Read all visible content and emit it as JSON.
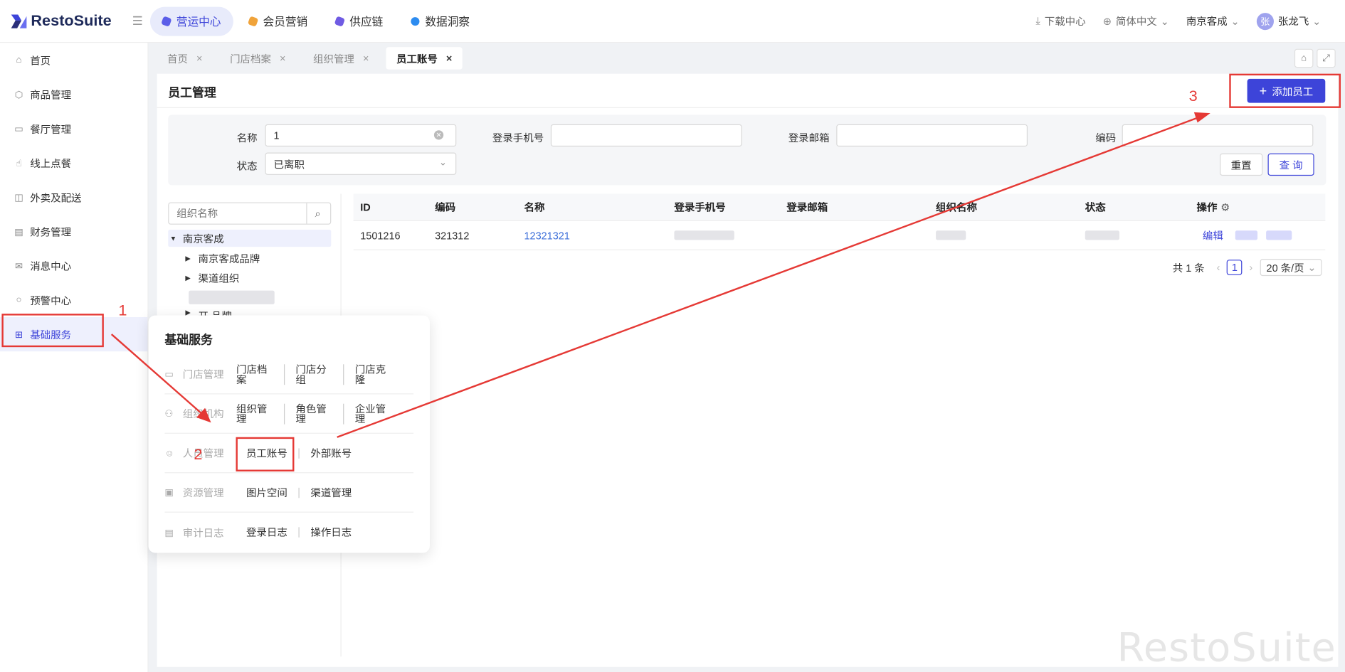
{
  "header": {
    "logo_text": "RestoSuite",
    "nav": [
      {
        "label": "营运中心",
        "active": true,
        "color": "#5b5ee8"
      },
      {
        "label": "会员营销",
        "active": false,
        "color": "#f0a33a"
      },
      {
        "label": "供应链",
        "active": false,
        "color": "#6f5be3"
      },
      {
        "label": "数据洞察",
        "active": false,
        "color": "#2d8cf0"
      }
    ],
    "download": "下载中心",
    "language": "简体中文",
    "store": "南京客成",
    "avatar_char": "张",
    "user": "张龙飞"
  },
  "sidebar": {
    "items": [
      {
        "label": "首页",
        "icon": "home-icon",
        "active": false
      },
      {
        "label": "商品管理",
        "icon": "box-icon",
        "active": false
      },
      {
        "label": "餐厅管理",
        "icon": "store-icon",
        "active": false
      },
      {
        "label": "线上点餐",
        "icon": "hand-icon",
        "active": false
      },
      {
        "label": "外卖及配送",
        "icon": "bag-icon",
        "active": false
      },
      {
        "label": "财务管理",
        "icon": "wallet-icon",
        "active": false
      },
      {
        "label": "消息中心",
        "icon": "mail-icon",
        "active": false
      },
      {
        "label": "预警中心",
        "icon": "bulb-icon",
        "active": false
      },
      {
        "label": "基础服务",
        "icon": "grid-icon",
        "active": true
      }
    ]
  },
  "tabs": [
    {
      "label": "首页",
      "active": false
    },
    {
      "label": "门店档案",
      "active": false
    },
    {
      "label": "组织管理",
      "active": false
    },
    {
      "label": "员工账号",
      "active": true
    }
  ],
  "page": {
    "title": "员工管理",
    "add_button": "添加员工"
  },
  "filter": {
    "name_label": "名称",
    "name_value": "1",
    "phone_label": "登录手机号",
    "email_label": "登录邮箱",
    "code_label": "编码",
    "status_label": "状态",
    "status_value": "已离职",
    "reset_button": "重置",
    "query_button": "查 询"
  },
  "tree": {
    "search_placeholder": "组织名称",
    "root": "南京客成",
    "children": [
      "南京客成品牌",
      "渠道组织"
    ],
    "partial": "开 品牌"
  },
  "table": {
    "columns": [
      "ID",
      "编码",
      "名称",
      "登录手机号",
      "登录邮箱",
      "组织名称",
      "状态",
      "操作"
    ],
    "rows": [
      {
        "id": "1501216",
        "code": "321312",
        "name": "12321321",
        "action": "编辑"
      }
    ]
  },
  "pagination": {
    "total": "共 1 条",
    "page": "1",
    "page_size": "20 条/页"
  },
  "popup": {
    "title": "基础服务",
    "rows": [
      {
        "category": "门店管理",
        "icon": "store-icon",
        "links": [
          "门店档案",
          "门店分组",
          "门店克隆"
        ]
      },
      {
        "category": "组织机构",
        "icon": "org-icon",
        "links": [
          "组织管理",
          "角色管理",
          "企业管理"
        ]
      },
      {
        "category": "人员管理",
        "icon": "people-icon",
        "links": [
          "员工账号",
          "外部账号"
        ]
      },
      {
        "category": "资源管理",
        "icon": "image-icon",
        "links": [
          "图片空间",
          "渠道管理"
        ]
      },
      {
        "category": "审计日志",
        "icon": "log-icon",
        "links": [
          "登录日志",
          "操作日志"
        ]
      }
    ]
  },
  "annotations": {
    "step1": "1",
    "step2": "2",
    "step3": "3",
    "color": "#e53935"
  },
  "watermark": "RestoSuite"
}
